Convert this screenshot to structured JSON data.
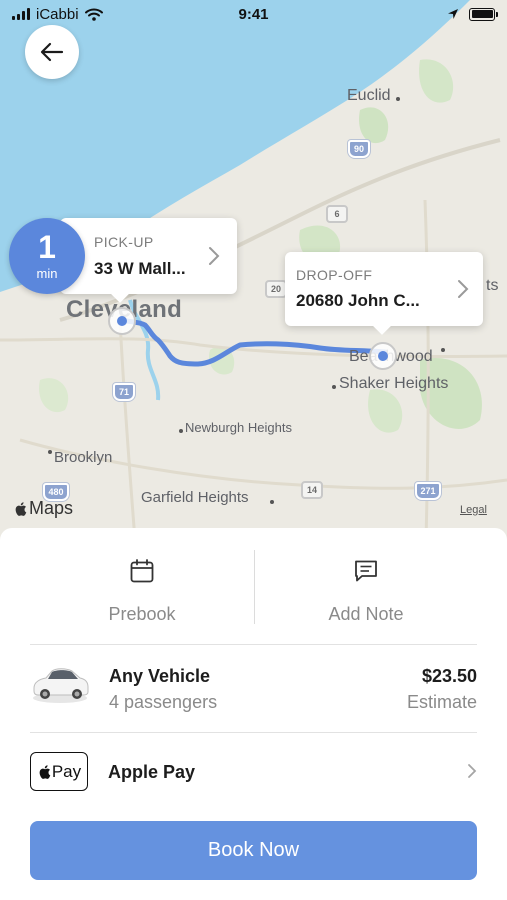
{
  "status_bar": {
    "carrier": "iCabbi",
    "time": "9:41"
  },
  "map": {
    "places": {
      "euclid": "Euclid",
      "cleveland": "Cleveland",
      "beachwood": "Beachwood",
      "shaker_heights": "Shaker Heights",
      "newburgh_heights": "Newburgh Heights",
      "brooklyn": "Brooklyn",
      "garfield_heights": "Garfield Heights",
      "edge_ts": "ts"
    },
    "shields": {
      "i90": "90",
      "r6": "6",
      "i71": "71",
      "i480": "480",
      "r14": "14",
      "i271": "271",
      "r20": "20"
    },
    "attribution": {
      "maps": "Maps",
      "legal": "Legal"
    },
    "route_color": "#5b87dc"
  },
  "pickup": {
    "eta_value": "1",
    "eta_unit": "min",
    "label": "PICK-UP",
    "address": "33 W Mall..."
  },
  "dropoff": {
    "label": "DROP-OFF",
    "address": "20680 John C..."
  },
  "actions": {
    "prebook": "Prebook",
    "add_note": "Add Note"
  },
  "vehicle": {
    "name": "Any Vehicle",
    "passengers": "4 passengers",
    "price": "$23.50",
    "price_note": "Estimate"
  },
  "payment": {
    "badge_text": "Pay",
    "method": "Apple Pay"
  },
  "cta": {
    "book_label": "Book Now",
    "color": "#6592df"
  }
}
